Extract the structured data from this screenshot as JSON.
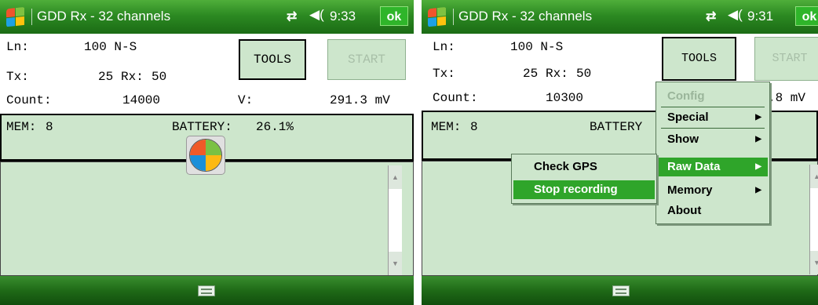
{
  "left_screen": {
    "title": "GDD Rx - 32 channels",
    "time": "9:33",
    "ok_label": "ok",
    "ln_label": "Ln:",
    "ln_value": "100 N-S",
    "tx_label": "Tx:",
    "tx_value": "25",
    "rx_label": "Rx:",
    "rx_value": "50",
    "count_label": "Count:",
    "count_value": "14000",
    "v_label": "V:",
    "v_value": "291.3 mV",
    "tools_label": "TOOLS",
    "start_label": "START",
    "mem_label": "MEM:",
    "mem_value": "8",
    "battery_label": "BATTERY:",
    "battery_value": "26.1%",
    "icons": {
      "windows": "windows-logo-icon",
      "sync": "connectivity-icon",
      "speaker": "speaker-icon",
      "keyboard": "keyboard-icon",
      "start_orb": "windows-start-orb-icon"
    }
  },
  "right_screen": {
    "title": "GDD Rx - 32 channels",
    "time": "9:31",
    "ok_label": "ok",
    "ln_label": "Ln:",
    "ln_value": "100 N-S",
    "tx_label": "Tx:",
    "tx_value": "25",
    "rx_label": "Rx:",
    "rx_value": "50",
    "count_label": "Count:",
    "count_value": "10300",
    "v_partial": ".8 mV",
    "tools_label": "TOOLS",
    "start_label": "START",
    "mem_label": "MEM:",
    "mem_value": "8",
    "battery_partial": "BATTERY",
    "menu": {
      "items": [
        {
          "label": "Config",
          "disabled": true,
          "submenu": false
        },
        {
          "label": "Special",
          "disabled": false,
          "submenu": true
        },
        {
          "label": "Show",
          "disabled": false,
          "submenu": true
        },
        {
          "label": "Raw Data",
          "disabled": false,
          "submenu": true,
          "highlighted": true
        },
        {
          "label": "Memory",
          "disabled": false,
          "submenu": true
        },
        {
          "label": "About",
          "disabled": false,
          "submenu": false
        }
      ]
    },
    "submenu": {
      "items": [
        {
          "label": "Check GPS",
          "highlighted": false
        },
        {
          "label": "Stop recording",
          "highlighted": true
        }
      ]
    }
  },
  "colors": {
    "titlebar_green": "#2c8a22",
    "panel_green": "#cde6cc",
    "highlight_green": "#2fa52a",
    "ok_button_green": "#2fb52a"
  }
}
